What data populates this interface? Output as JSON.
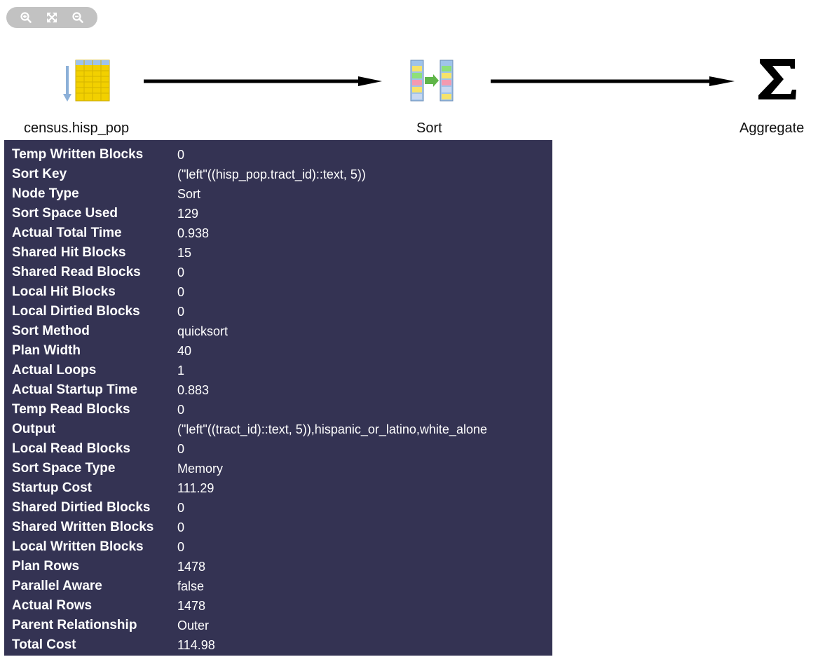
{
  "toolbar": {
    "buttons": [
      {
        "name": "zoom-in",
        "icon": "zoom-in-icon"
      },
      {
        "name": "fit-to-screen",
        "icon": "expand-icon"
      },
      {
        "name": "zoom-out",
        "icon": "zoom-out-icon"
      }
    ]
  },
  "nodes": [
    {
      "id": "scan",
      "label": "census.hisp_pop",
      "icon": "table-scan-icon"
    },
    {
      "id": "sort",
      "label": "Sort",
      "icon": "sort-icon"
    },
    {
      "id": "aggregate",
      "label": "Aggregate",
      "icon": "sigma-icon"
    }
  ],
  "details": [
    {
      "key": "Temp Written Blocks",
      "value": "0"
    },
    {
      "key": "Sort Key",
      "value": "(\"left\"((hisp_pop.tract_id)::text, 5))"
    },
    {
      "key": "Node Type",
      "value": "Sort"
    },
    {
      "key": "Sort Space Used",
      "value": "129"
    },
    {
      "key": "Actual Total Time",
      "value": "0.938"
    },
    {
      "key": "Shared Hit Blocks",
      "value": "15"
    },
    {
      "key": "Shared Read Blocks",
      "value": "0"
    },
    {
      "key": "Local Hit Blocks",
      "value": "0"
    },
    {
      "key": "Local Dirtied Blocks",
      "value": "0"
    },
    {
      "key": "Sort Method",
      "value": "quicksort"
    },
    {
      "key": "Plan Width",
      "value": "40"
    },
    {
      "key": "Actual Loops",
      "value": "1"
    },
    {
      "key": "Actual Startup Time",
      "value": "0.883"
    },
    {
      "key": "Temp Read Blocks",
      "value": "0"
    },
    {
      "key": "Output",
      "value": "(\"left\"((tract_id)::text, 5)),hispanic_or_latino,white_alone"
    },
    {
      "key": "Local Read Blocks",
      "value": "0"
    },
    {
      "key": "Sort Space Type",
      "value": "Memory"
    },
    {
      "key": "Startup Cost",
      "value": "111.29"
    },
    {
      "key": "Shared Dirtied Blocks",
      "value": "0"
    },
    {
      "key": "Shared Written Blocks",
      "value": "0"
    },
    {
      "key": "Local Written Blocks",
      "value": "0"
    },
    {
      "key": "Plan Rows",
      "value": "1478"
    },
    {
      "key": "Parallel Aware",
      "value": "false"
    },
    {
      "key": "Actual Rows",
      "value": "1478"
    },
    {
      "key": "Parent Relationship",
      "value": "Outer"
    },
    {
      "key": "Total Cost",
      "value": "114.98"
    }
  ],
  "colors": {
    "panel_bg": "#343353",
    "panel_text": "#ffffff",
    "toolbar_bg": "#c2c2c2",
    "edge": "#000000"
  }
}
